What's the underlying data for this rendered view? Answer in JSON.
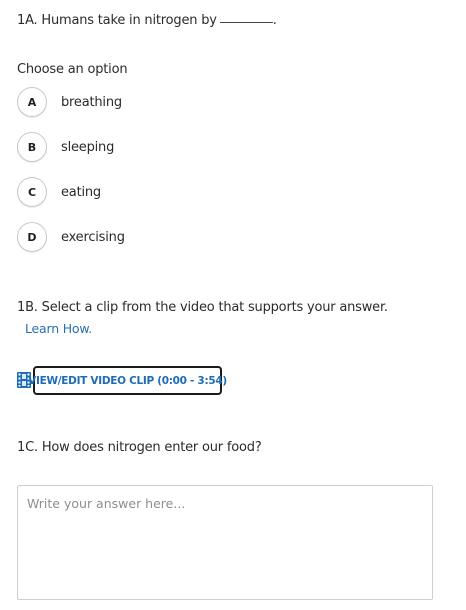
{
  "question_1a": {
    "text": "1A. Humans take in nitrogen by",
    "blank_end": "."
  },
  "choose_label": "Choose an option",
  "options": [
    {
      "letter": "A",
      "text": "breathing"
    },
    {
      "letter": "B",
      "text": "sleeping"
    },
    {
      "letter": "C",
      "text": "eating"
    },
    {
      "letter": "D",
      "text": "exercising"
    }
  ],
  "question_1b": {
    "text": "1B. Select a clip from the video that supports your answer.",
    "learn_link": "Learn How.",
    "clip_button": "VIEW/EDIT VIDEO CLIP (0:00 - 3:54)",
    "clip_icon": "film-icon",
    "accent_color": "#1f6bb5"
  },
  "question_1c": {
    "text": "1C. How does nitrogen enter our food?",
    "answer_placeholder": "Write your answer here..."
  }
}
